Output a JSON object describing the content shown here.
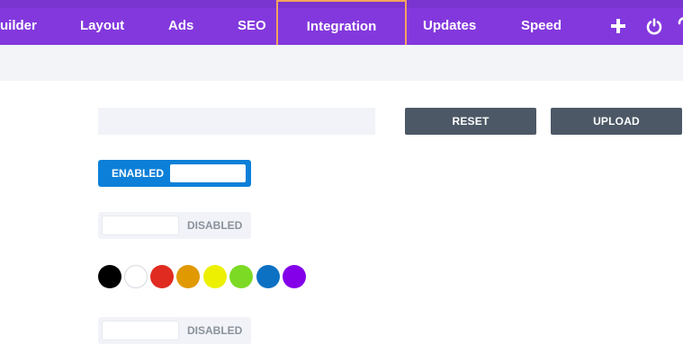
{
  "nav": {
    "tabs": [
      {
        "label": "uilder"
      },
      {
        "label": "Layout"
      },
      {
        "label": "Ads"
      },
      {
        "label": "SEO"
      },
      {
        "label": "Integration",
        "active": true
      },
      {
        "label": "Updates"
      },
      {
        "label": "Speed"
      }
    ],
    "icons": [
      "plus-icon",
      "power-icon",
      "help-icon"
    ]
  },
  "buttons": {
    "reset": "RESET",
    "upload": "UPLOAD"
  },
  "toggles": {
    "first": {
      "state_label": "ENABLED",
      "enabled": true
    },
    "second": {
      "state_label": "DISABLED",
      "enabled": false
    },
    "third": {
      "state_label": "DISABLED",
      "enabled": false
    }
  },
  "colors": {
    "brand_purple": "#8338dd",
    "highlight": "#f4a35c",
    "toggle_on": "#0c80d8",
    "button_dark": "#4c5866",
    "swatches": [
      "#000000",
      "#ffffff",
      "#e02b20",
      "#e09900",
      "#edf000",
      "#7cda24",
      "#0c71c3",
      "#8300e9"
    ]
  }
}
